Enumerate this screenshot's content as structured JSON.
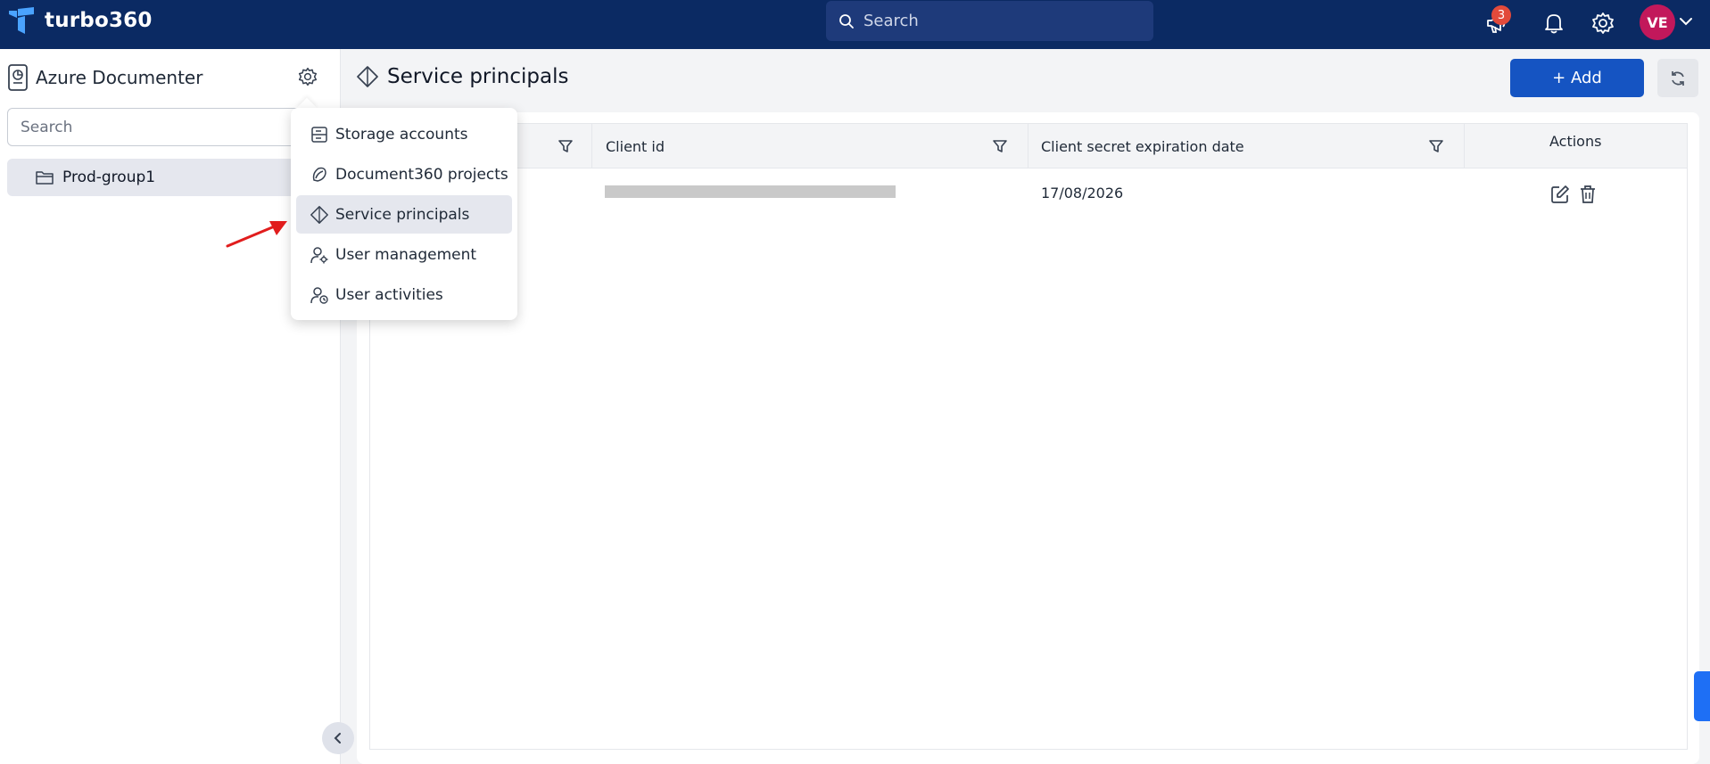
{
  "header": {
    "brand": "turbo360",
    "search_placeholder": "Search",
    "notification_count": "3",
    "avatar_initials": "VE"
  },
  "sidebar": {
    "app_title": "Azure Documenter",
    "search_placeholder": "Search",
    "tree": [
      {
        "label": "Prod-group1"
      }
    ]
  },
  "settings_menu": {
    "items": [
      {
        "label": "Storage accounts",
        "icon": "storage-icon"
      },
      {
        "label": "Document360 projects",
        "icon": "document360-icon"
      },
      {
        "label": "Service principals",
        "icon": "service-principal-icon",
        "active": true
      },
      {
        "label": "User management",
        "icon": "user-gear-icon"
      },
      {
        "label": "User activities",
        "icon": "user-clock-icon"
      }
    ]
  },
  "main": {
    "page_title": "Service principals",
    "add_label": "+ Add",
    "table": {
      "columns": [
        "Client id",
        "Client secret expiration date",
        "Actions"
      ],
      "rows": [
        {
          "client_id": "",
          "expiration": "17/08/2026"
        }
      ]
    }
  },
  "colors": {
    "topbar": "#0b2a63",
    "primary": "#1554c2",
    "badge": "#e24a3b",
    "avatar": "#c2185b",
    "annotation_arrow": "#e11d1d"
  }
}
